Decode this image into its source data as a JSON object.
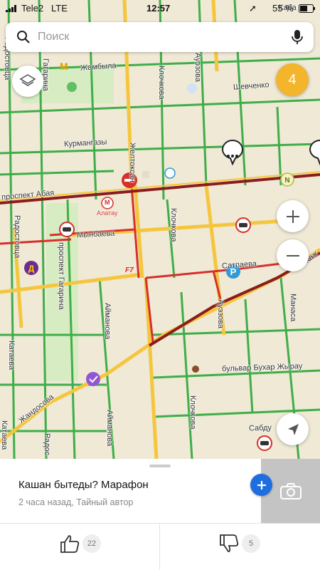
{
  "status_bar": {
    "carrier": "Tele2",
    "network": "LTE",
    "time": "12:57",
    "battery": "55 %"
  },
  "search": {
    "placeholder": "Поиск"
  },
  "traffic": {
    "level": "4",
    "color": "#f2b52c"
  },
  "map": {
    "streets": {
      "zhambyla": "Жамбыла",
      "shevchenko": "Шевченко",
      "kurmangazy": "Курмангазы",
      "abaya": "проспект Абая",
      "mynbaeva": "Мынбаева",
      "satpaeva": "Сатпаева",
      "buhar": "бульвар Бухар Жырау",
      "sabdu": "Сабду",
      "zhandosova": "Жандосова",
      "klochkova_1": "Клочкова",
      "klochkova_2": "Клочкова",
      "klochkova_3": "Клочкова",
      "auezova_1": "Ауэзова",
      "auezova_2": "Ауэзова",
      "aymanova_1": "Айманова",
      "aymanova_2": "Айманова",
      "gagarina_1": "Гагарина",
      "gagarina_2": "проспект Гагарина",
      "radostovtsa_1": "Радостовца",
      "radostovtsa_2": "Радостовца",
      "radostovtsa_3": "Радос",
      "kataeva_1": "Катаева",
      "kataeva_2": "Катаева",
      "manasa": "Манаса",
      "zheltoksan": "Желтоксан",
      "kab": "Каба",
      "kaj": "Каж"
    },
    "poi": {
      "metro": "Алатау",
      "metro_letter": "М"
    },
    "colors": {
      "green": "#3fae49",
      "yellow": "#f5c63d",
      "red": "#d6302a",
      "darkred": "#8a1d1d"
    }
  },
  "event": {
    "title": "Кашан бытеды? Марафон",
    "meta": "2 часа назад, Тайный автор"
  },
  "votes": {
    "likes": "22",
    "dislikes": "5"
  }
}
